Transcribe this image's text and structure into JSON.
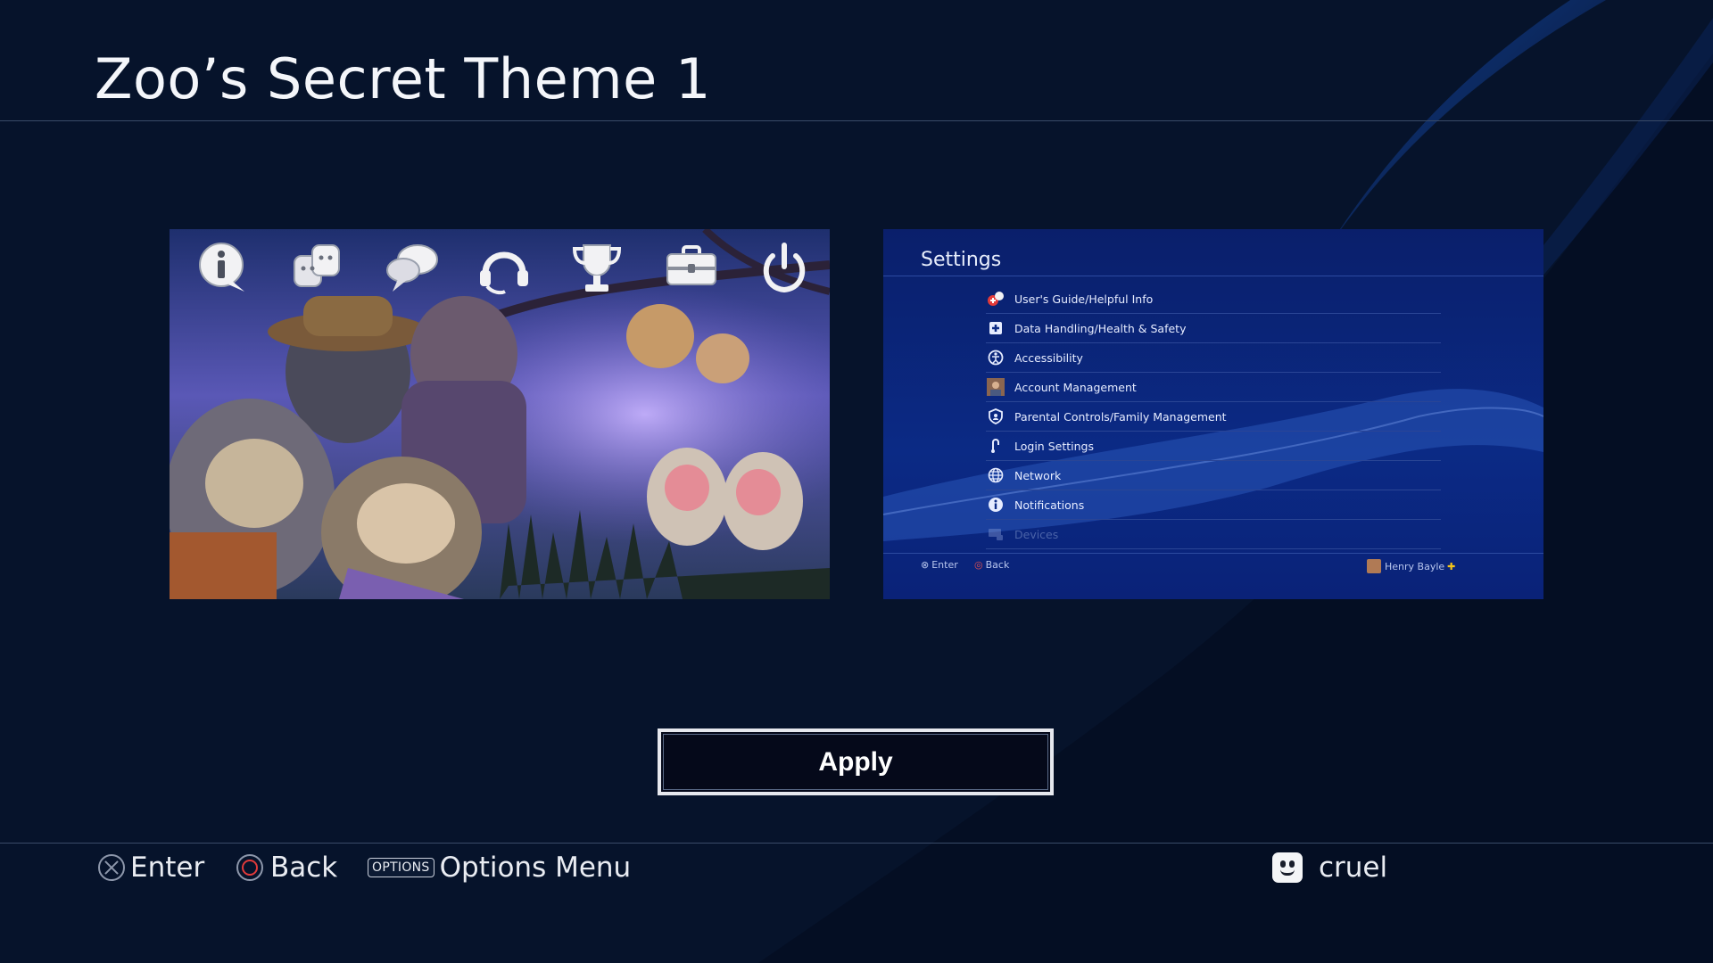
{
  "page": {
    "title": "Zoo’s Secret Theme 1"
  },
  "colors": {
    "background": "#06132b",
    "settings_bg": "#0b2a85",
    "accent_blue": "#1e5bd6"
  },
  "theme_preview": {
    "function_icons": [
      "info-icon",
      "friends-icon",
      "messages-icon",
      "party-icon",
      "trophy-icon",
      "settings-icon",
      "power-icon"
    ]
  },
  "settings_preview": {
    "title": "Settings",
    "items": [
      {
        "label": "User's Guide/Helpful Info",
        "icon": "helpful-info-icon"
      },
      {
        "label": "Data Handling/Health & Safety",
        "icon": "health-safety-icon"
      },
      {
        "label": "Accessibility",
        "icon": "accessibility-icon"
      },
      {
        "label": "Account Management",
        "icon": "account-avatar-icon"
      },
      {
        "label": "Parental Controls/Family Management",
        "icon": "parental-controls-icon"
      },
      {
        "label": "Login Settings",
        "icon": "login-icon"
      },
      {
        "label": "Network",
        "icon": "network-globe-icon"
      },
      {
        "label": "Notifications",
        "icon": "notifications-icon"
      },
      {
        "label": "Devices",
        "icon": "devices-icon"
      }
    ],
    "footer": {
      "enter": "Enter",
      "back": "Back",
      "user": "Henry Bayle"
    }
  },
  "apply_button": {
    "label": "Apply"
  },
  "footer": {
    "enter": "Enter",
    "back": "Back",
    "options_key": "OPTIONS",
    "options_label": "Options Menu",
    "username": "cruel"
  }
}
